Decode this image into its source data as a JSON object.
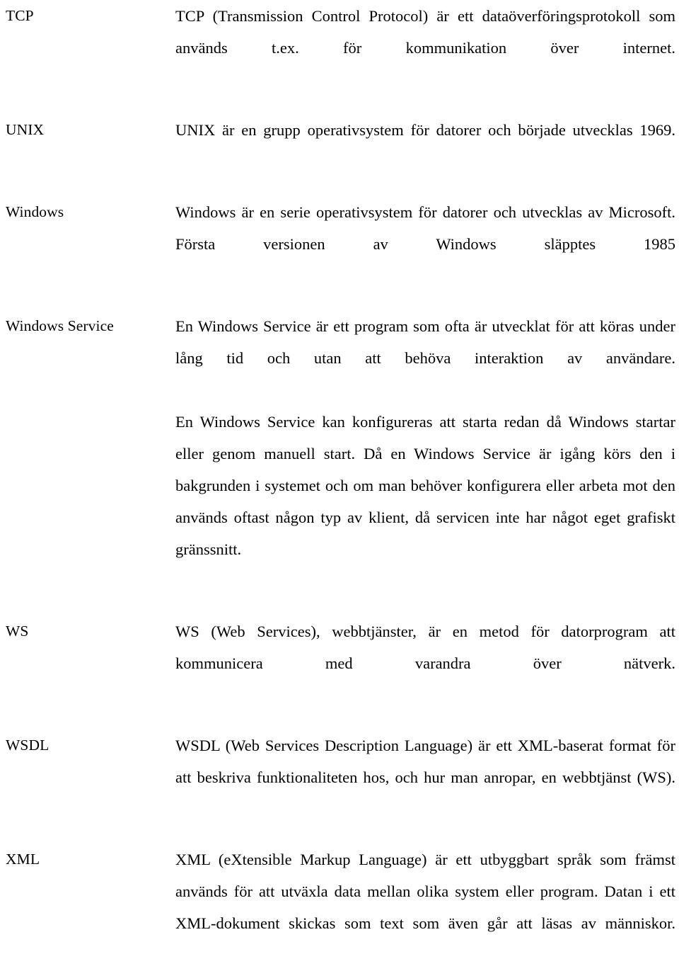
{
  "document": {
    "language": "sv",
    "type": "glossary",
    "text_color": "#000000",
    "background_color": "#ffffff"
  },
  "glossary": {
    "entries": [
      {
        "term": "TCP",
        "definition": "TCP (Transmission Control Protocol) är ett dataöverföringsproto­koll som används t.ex. för kommunikation över internet."
      },
      {
        "term": "UNIX",
        "definition": "UNIX är en grupp operativsystem för datorer och började utvecklas 1969."
      },
      {
        "term": "Windows",
        "definition": "Windows är en serie operativsystem för datorer och utvecklas av Microsoft. Första versionen av Windows släpptes 1985"
      },
      {
        "term": "Windows Service",
        "definition_part_1": "En Windows Service är ett program som ofta är utvecklat för att köras under lång tid och utan att behöva interaktion av användare.",
        "definition_part_2": "En Windows Service kan konfigureras att starta redan då Windows startar eller genom manuell start. Då en Windows Service är igång körs den i bakgrunden i systemet och om man behöver konfigurera eller arbeta mot den används oftast någon typ av klient, då servicen inte har något eget grafiskt gränssnitt."
      },
      {
        "term": "WS",
        "definition": "WS (Web Services), webbtjänster, är en metod för datorprogram att kommunicera med varandra över nätverk."
      },
      {
        "term": "WSDL",
        "definition": "WSDL (Web Services Description Language) är ett XML-baserat format för att beskriva funktionaliteten hos, och hur man anropar, en webbtjänst (WS)."
      },
      {
        "term": "XML",
        "definition": "XML (eXtensible Markup Language) är ett utbyggbart språk som främst används för att utväxla data mellan olika system eller pro­gram. Datan i ett XML-dokument skickas som text som även går att läsas av människor."
      }
    ]
  }
}
